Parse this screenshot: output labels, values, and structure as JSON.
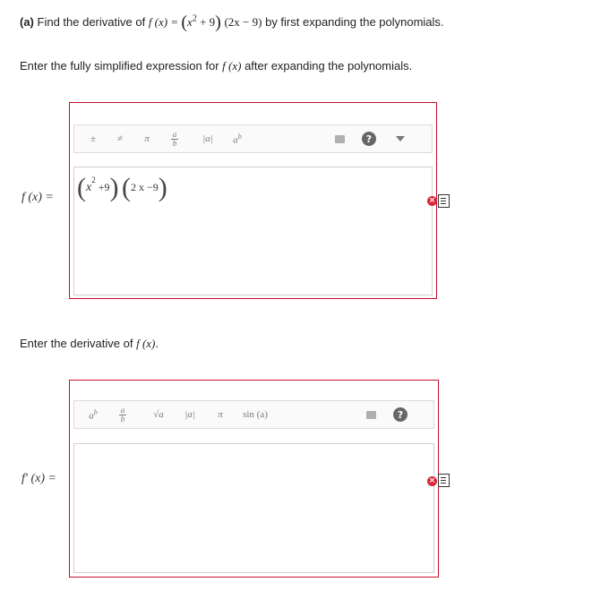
{
  "question": {
    "part": "(a)",
    "text_before": "Find the derivative of ",
    "fx": "f (x) = ",
    "expr_a": "x",
    "expr_a_exp": "2",
    "expr_a_rest": " + 9",
    "expr_b": "(2x − 9)",
    "text_after": " by first expanding the polynomials."
  },
  "prompt1": {
    "text": "Enter the fully simplified expression for ",
    "fx": "f (x)",
    "text_after": " after expanding the polynomials."
  },
  "prompt2": {
    "text": "Enter the derivative of ",
    "fx": "f (x)",
    "text_after": "."
  },
  "editor1": {
    "label": "f (x) =",
    "toolbar": [
      "±",
      "≠",
      "π",
      "a/b",
      "|a|",
      "a^b",
      "keyboard",
      "help",
      "expand"
    ],
    "value": {
      "open": "(",
      "base": "x",
      "exp": "2",
      "plus": " +9",
      "close": ")",
      "open2": "(",
      "second": "2 x −9",
      "close2": ")"
    }
  },
  "editor2": {
    "label": "f′ (x) =",
    "toolbar": [
      "a^b",
      "a/b",
      "√a",
      "|a|",
      "π",
      "sin (a)",
      "keyboard",
      "help"
    ],
    "value": ""
  },
  "icons": {
    "status": "incorrect-icon",
    "doc": "document-icon"
  },
  "colors": {
    "error": "#c8102e"
  }
}
